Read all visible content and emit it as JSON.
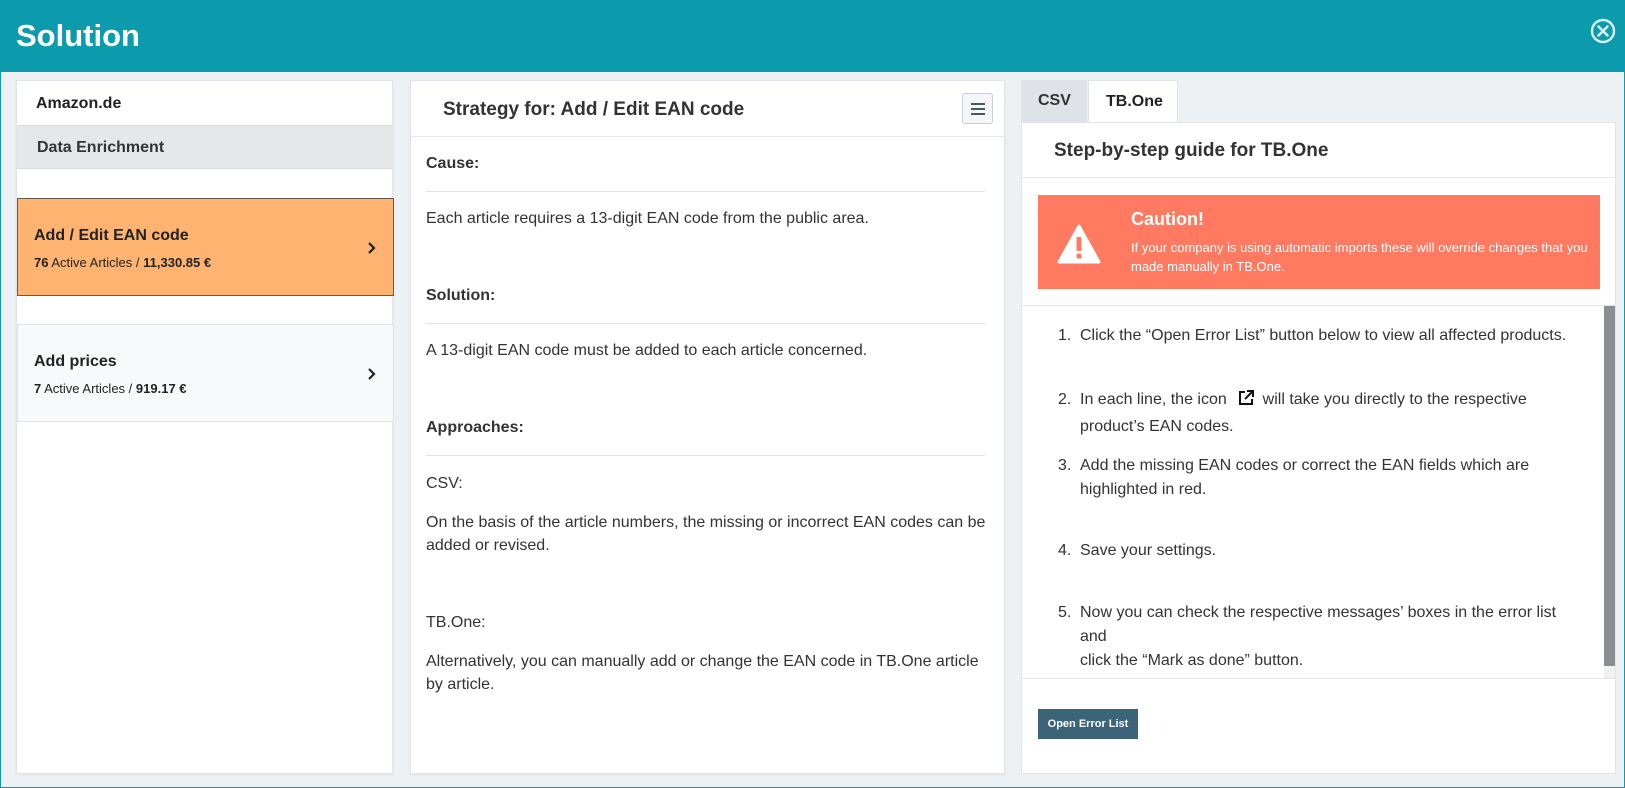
{
  "window": {
    "title": "Solution"
  },
  "left": {
    "market": "Amazon.de",
    "category": "Data Enrichment",
    "issues": [
      {
        "title": "Add / Edit EAN code",
        "count": "76",
        "count_label": "Active Articles /",
        "amount": "11,330.85 €",
        "active": true
      },
      {
        "title": "Add prices",
        "count": "7",
        "count_label": "Active Articles /",
        "amount": "919.17 €",
        "active": false
      }
    ]
  },
  "middle": {
    "header": "Strategy for: Add / Edit EAN code",
    "cause_head": "Cause:",
    "cause_text": "Each article requires a 13-digit EAN code from the public area.",
    "solution_head": "Solution:",
    "solution_text": "A 13-digit EAN code must be added to each article concerned.",
    "approaches_head": "Approaches:",
    "csv_label": "CSV:",
    "csv_text_1": "On the basis of the article numbers, the missing or incorrect EAN codes can be",
    "csv_text_2": "added or revised.",
    "tbone_label": "TB.One:",
    "tbone_text_1": "Alternatively, you can manually add or change the EAN code in TB.One article",
    "tbone_text_2": "by article."
  },
  "right": {
    "tabs": [
      "CSV",
      "TB.One"
    ],
    "active_tab": "TB.One",
    "title": "Step-by-step guide for TB.One",
    "caution": {
      "title": "Caution!",
      "message": "If your company is using automatic imports these will override changes that you made manually in TB.One."
    },
    "steps": [
      {
        "num": "1.",
        "line1": "Click the “Open Error List” button below to view all affected products.",
        "line2": ""
      },
      {
        "num": "2.",
        "line1a": "In each line, the icon",
        "line1b": "will take you directly to the respective",
        "line2": "product’s EAN codes."
      },
      {
        "num": "3.",
        "line1": "Add the missing EAN codes or correct the EAN fields which are",
        "line2": "highlighted in red."
      },
      {
        "num": "4.",
        "line1": "Save your settings.",
        "line2": ""
      },
      {
        "num": "5.",
        "line1": "Now you can check the respective messages’ boxes in the error list and",
        "line2": "click the “Mark as done” button."
      }
    ],
    "open_button": "Open Error List"
  },
  "colors": {
    "titlebar": "#0c9aad",
    "active_card": "#ffb370",
    "caution": "#ff7a61",
    "button": "#3c6478"
  }
}
